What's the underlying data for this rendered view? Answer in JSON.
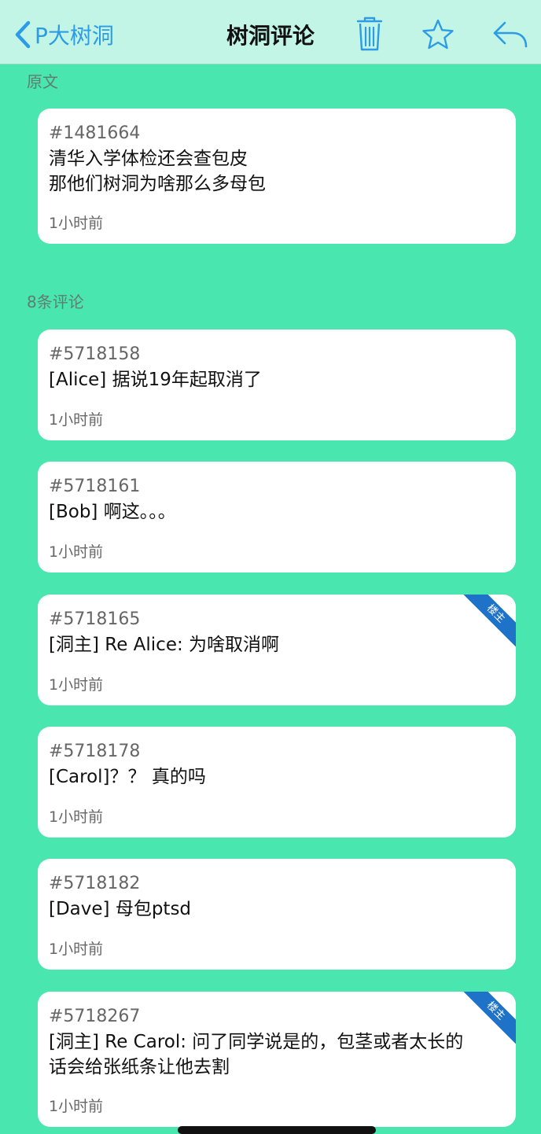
{
  "nav": {
    "back_label": "P大树洞",
    "title": "树洞评论"
  },
  "original": {
    "section_label": "原文",
    "id": "#1481664",
    "lines": [
      "清华入学体检还会查包皮",
      "那他们树洞为啥那么多母包"
    ],
    "time": "1小时前"
  },
  "comments_header": "8条评论",
  "comments": [
    {
      "id": "#5718158",
      "text": "[Alice] 据说19年起取消了",
      "time": "1小时前",
      "badge": ""
    },
    {
      "id": "#5718161",
      "text": "[Bob] 啊这。。。",
      "time": "1小时前",
      "badge": ""
    },
    {
      "id": "#5718165",
      "text": "[洞主] Re Alice: 为啥取消啊",
      "time": "1小时前",
      "badge": "楼主"
    },
    {
      "id": "#5718178",
      "text": "[Carol]？？ 真的吗",
      "time": "1小时前",
      "badge": ""
    },
    {
      "id": "#5718182",
      "text": "[Dave] 母包ptsd",
      "time": "1小时前",
      "badge": ""
    },
    {
      "id": "#5718267",
      "lines": [
        "[洞主] Re Carol: 问了同学说是的，包茎或者太长的",
        "话会给张纸条让他去割"
      ],
      "time": "1小时前",
      "badge": "楼主"
    }
  ],
  "colors": {
    "background": "#4ae6b0",
    "navbar": "#c2f5e6",
    "accent": "#2d9be5",
    "ribbon": "#1e73c8"
  }
}
